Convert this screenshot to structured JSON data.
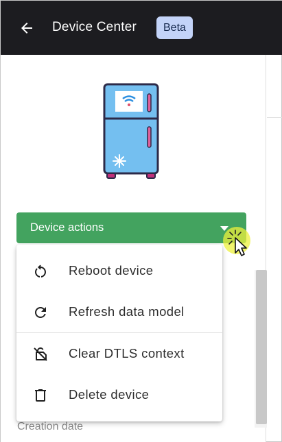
{
  "appbar": {
    "title": "Device Center",
    "badge": "Beta",
    "back_icon": "arrow-left-icon",
    "background": "#1c1c20"
  },
  "device": {
    "image_icon": "refrigerator-icon"
  },
  "actions": {
    "button_label": "Device actions",
    "caret_icon": "caret-down-icon",
    "accent": "#43a35f"
  },
  "menu": {
    "items": [
      {
        "label": "Reboot device",
        "icon": "reboot-icon"
      },
      {
        "label": "Refresh data model",
        "icon": "refresh-icon"
      },
      {
        "label": "Clear DTLS context",
        "icon": "lock-off-icon"
      },
      {
        "label": "Delete device",
        "icon": "trash-icon"
      }
    ]
  },
  "details": {
    "creation_date_label": "Creation date"
  }
}
